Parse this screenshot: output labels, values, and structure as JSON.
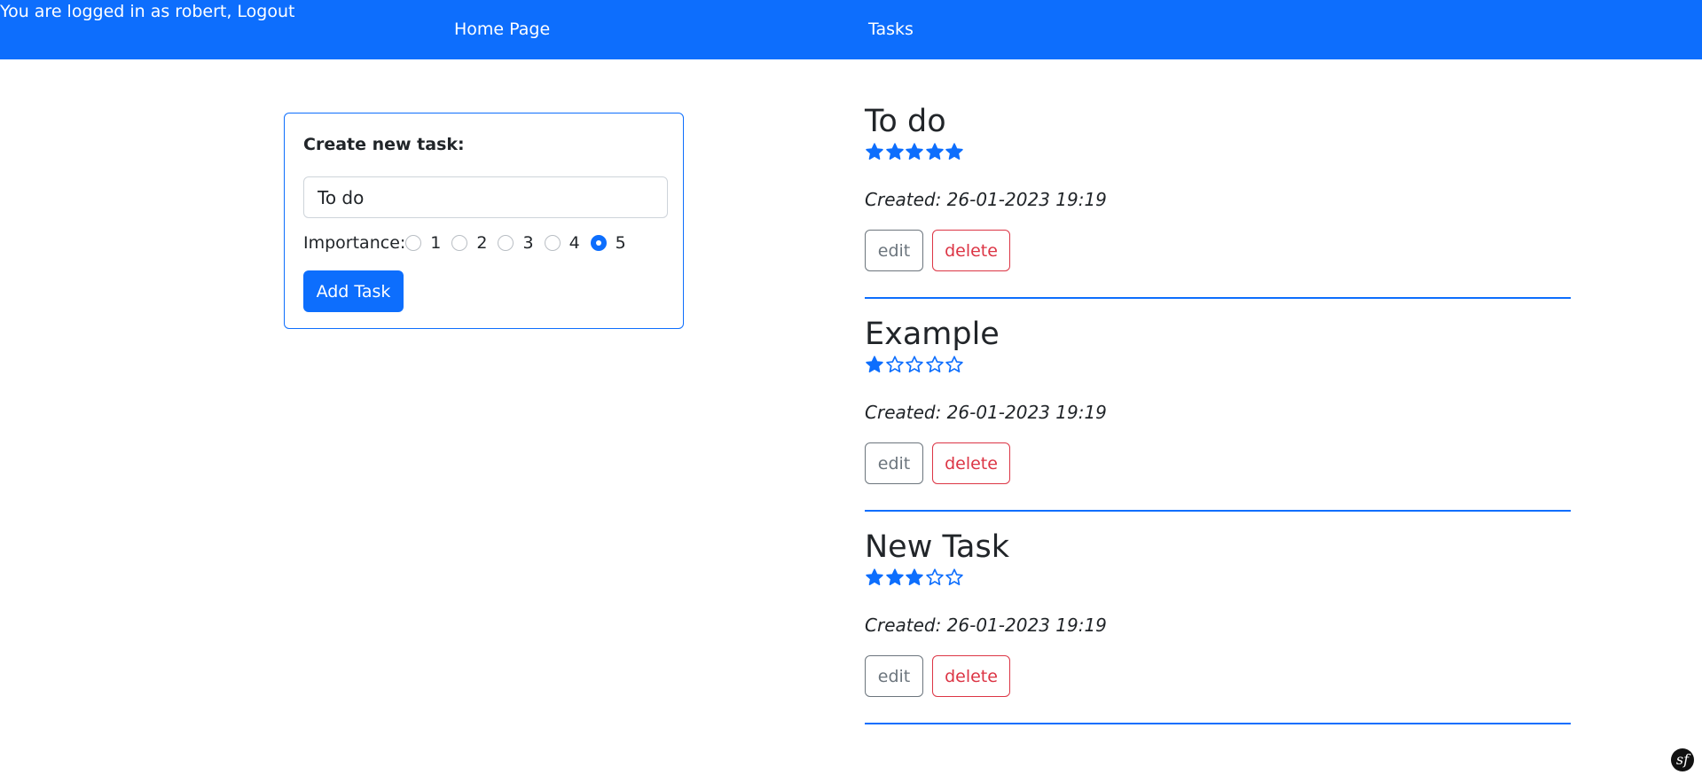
{
  "nav": {
    "user_text": "You are logged in as robert, Logout",
    "home": "Home Page",
    "tasks": "Tasks",
    "bg_color": "#0d6efd"
  },
  "form": {
    "title": "Create new task:",
    "task_value": "To do",
    "importance_label": "Importance:",
    "options": [
      "1",
      "2",
      "3",
      "4",
      "5"
    ],
    "selected": "5",
    "submit_label": "Add Task"
  },
  "tasks": [
    {
      "title": "To do",
      "rating": 5,
      "created": "Created: 26-01-2023 19:19",
      "edit_label": "edit",
      "delete_label": "delete"
    },
    {
      "title": "Example",
      "rating": 1,
      "created": "Created: 26-01-2023 19:19",
      "edit_label": "edit",
      "delete_label": "delete"
    },
    {
      "title": "New Task",
      "rating": 3,
      "created": "Created: 26-01-2023 19:19",
      "edit_label": "edit",
      "delete_label": "delete"
    }
  ],
  "colors": {
    "accent": "#0d6efd",
    "danger": "#dc3545",
    "secondary": "#6c757d"
  },
  "footer": {
    "logo_icon": "symfony-logo-icon",
    "logo_glyph": "sf"
  }
}
